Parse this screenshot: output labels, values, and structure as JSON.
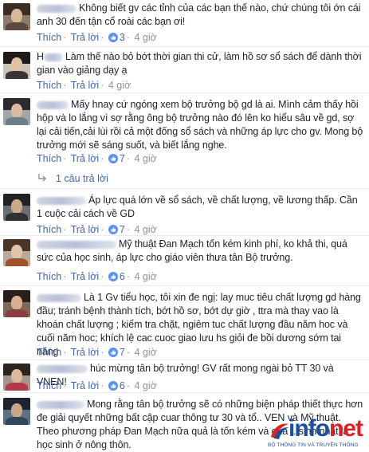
{
  "like_label": "Thích",
  "reply_label": "Trả lời",
  "dot": "·",
  "comments": [
    {
      "name_prefix": "",
      "text": "Không biết gv các tỉnh của các bạn thế nào, chứ chúng tôi ớn cái anh 30 đến tận cổ roài các bạn ơi!",
      "likes": "3",
      "time": "4 giờ"
    },
    {
      "name_prefix": "H",
      "text": "Làm thế nào bỏ bớt thời gian thi cử, làm hồ sơ sổ sách để dành thời gian vào giảng dạy ạ",
      "likes": "",
      "time": "4 giờ"
    },
    {
      "name_prefix": "",
      "text": "Mấy hnay cứ ngóng xem bộ trưởng bộ gd là ai. Mình cảm thấy hồi hộp và lo lắng vì sợ rằng ông bộ trưởng nào đó lên ko hiểu sâu về gd, sợ lại cải tiến,cải lùi rồi cả một đống sổ sách và những áp lực cho gv. Mong bộ trưởng mới sẽ sáng suốt, và biết lắng nghe.",
      "likes": "7",
      "time": "4 giờ",
      "reply_count": "1 câu trả lời"
    },
    {
      "name_prefix": "",
      "text": "Áp lực quá lớn về sổ sách, về chất lượng, về lương thấp. Cần 1 cuộc cải cách về GD",
      "likes": "7",
      "time": "4 giờ"
    },
    {
      "name_prefix": "",
      "text": "Mỹ thuật Đan Mạch tốn kém kinh phí, ko khả thi, quá sức của học sinh, áp lực cho giáo viên thưa tân Bộ trưởng.",
      "likes": "6",
      "time": "4 giờ"
    },
    {
      "name_prefix": "",
      "text": "Là 1 Gv tiểu học, tôi xin đe ngị: lay muc tiêu chất lượng gd hàng đầu; tránh bệnh thành tích, bớt hồ sơ, bớt dự giờ , ttra mà thay vao là khoán chất lượng ; kiểm tra chặt, ngiêm tuc chất lượng đầu năm hoc và cuối năm hoc; khích lệ cac cuoc giao lưu hs giỏi đe bồi dương sớm tai năng",
      "likes": "7",
      "time": "4 giờ"
    },
    {
      "name_prefix": "",
      "text": "húc mừng tân bộ trưởng! GV rất mong ngài bỏ TT 30 và VNEN!",
      "likes": "6",
      "time": "4 giờ"
    },
    {
      "name_prefix": "",
      "text": "Mong rằng tân bộ trưởng sẽ có những biện pháp thiết thực hơn đe giải quyết những bất cập cuar thông tư 30 và tổ.. VEN và Mỹ thuật. Theo phương pháp Đan Mạch nữa quả là tốn kém và qua .. sinh nhất là học sinh ở nông thôn.",
      "likes": "",
      "time": ""
    }
  ],
  "logo": {
    "word_main": "info",
    "word_accent": "net",
    "tagline": "BỘ THÔNG TIN VÀ TRUYỀN THÔNG",
    "colors": {
      "primary": "#1a4fa3",
      "accent": "#e02020"
    }
  },
  "colors": {
    "link": "#4267b2",
    "muted": "#90949c",
    "text": "#1d2129"
  }
}
